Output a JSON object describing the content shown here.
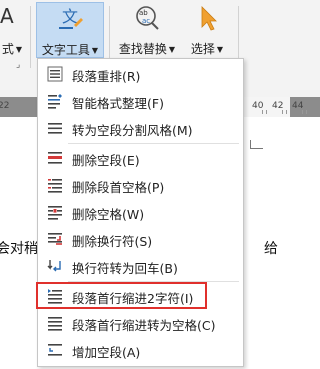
{
  "ribbon": {
    "left_partial_label": "式",
    "left_glyph": "A",
    "text_tools_label": "文字工具",
    "find_replace_label": "查找替换",
    "select_label": "选择"
  },
  "ruler": {
    "numbers": [
      "22",
      "40",
      "42",
      "44"
    ]
  },
  "document": {
    "left_text": "会对稍",
    "right_text": "给"
  },
  "menu": {
    "items": [
      {
        "label": "段落重排(R)",
        "icon": "paragraph-rearrange-icon"
      },
      {
        "label": "智能格式整理(F)",
        "icon": "smart-format-icon"
      },
      {
        "label": "转为空段分割风格(M)",
        "icon": "empty-paragraph-split-icon"
      },
      {
        "label": "删除空段(E)",
        "icon": "delete-empty-paragraph-icon"
      },
      {
        "label": "删除段首空格(P)",
        "icon": "delete-leading-space-icon"
      },
      {
        "label": "删除空格(W)",
        "icon": "delete-space-icon"
      },
      {
        "label": "删除换行符(S)",
        "icon": "delete-line-break-icon"
      },
      {
        "label": "换行符转为回车(B)",
        "icon": "line-break-to-enter-icon"
      },
      {
        "label": "段落首行缩进2字符(I)",
        "icon": "first-line-indent-icon"
      },
      {
        "label": "段落首行缩进转为空格(C)",
        "icon": "indent-to-space-icon"
      },
      {
        "label": "增加空段(A)",
        "icon": "add-empty-paragraph-icon"
      }
    ]
  },
  "colors": {
    "highlight": "#e0302c",
    "active_button": "#c5dcf3",
    "icon_blue": "#2b6cb3",
    "icon_red": "#d43a3a",
    "cursor_orange": "#f0a030"
  }
}
